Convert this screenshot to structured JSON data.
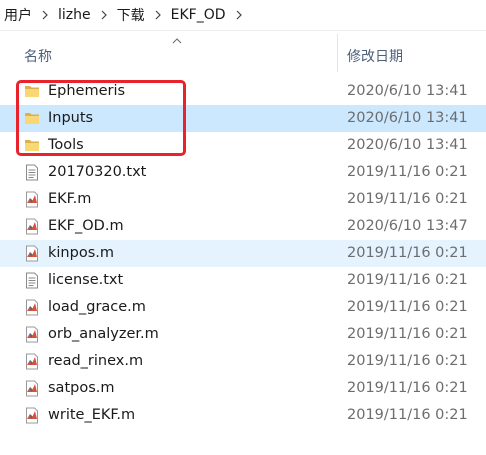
{
  "breadcrumb": [
    "用户",
    "lizhe",
    "下载",
    "EKF_OD"
  ],
  "header": {
    "name": "名称",
    "date": "修改日期"
  },
  "files": [
    {
      "name": "Ephemeris",
      "date": "2020/6/10 13:41",
      "type": "folder",
      "state": ""
    },
    {
      "name": "Inputs",
      "date": "2020/6/10 13:41",
      "type": "folder",
      "state": "selected"
    },
    {
      "name": "Tools",
      "date": "2020/6/10 13:41",
      "type": "folder",
      "state": ""
    },
    {
      "name": "20170320.txt",
      "date": "2019/11/16 0:21",
      "type": "text",
      "state": ""
    },
    {
      "name": "EKF.m",
      "date": "2019/11/16 0:21",
      "type": "matlab",
      "state": ""
    },
    {
      "name": "EKF_OD.m",
      "date": "2020/6/10 13:47",
      "type": "matlab",
      "state": ""
    },
    {
      "name": "kinpos.m",
      "date": "2019/11/16 0:21",
      "type": "matlab",
      "state": "hover"
    },
    {
      "name": "license.txt",
      "date": "2019/11/16 0:21",
      "type": "text",
      "state": ""
    },
    {
      "name": "load_grace.m",
      "date": "2019/11/16 0:21",
      "type": "matlab",
      "state": ""
    },
    {
      "name": "orb_analyzer.m",
      "date": "2019/11/16 0:21",
      "type": "matlab",
      "state": ""
    },
    {
      "name": "read_rinex.m",
      "date": "2019/11/16 0:21",
      "type": "matlab",
      "state": ""
    },
    {
      "name": "satpos.m",
      "date": "2019/11/16 0:21",
      "type": "matlab",
      "state": ""
    },
    {
      "name": "write_EKF.m",
      "date": "2019/11/16 0:21",
      "type": "matlab",
      "state": ""
    }
  ],
  "colors": {
    "selected": "#cce8ff",
    "hover": "#e5f3ff",
    "annotation": "#e8232b"
  }
}
